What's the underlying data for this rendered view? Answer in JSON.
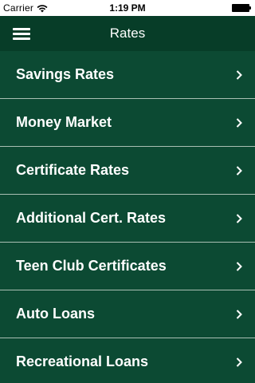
{
  "status_bar": {
    "carrier": "Carrier",
    "time": "1:19 PM",
    "icons": [
      "wifi-icon",
      "battery-icon"
    ]
  },
  "nav": {
    "title": "Rates",
    "menu_icon": "hamburger-menu-icon"
  },
  "colors": {
    "background": "#0c4a33",
    "nav_background": "#073d28",
    "text": "#ffffff",
    "separator": "#a9bfb3"
  },
  "list": {
    "items": [
      {
        "label": "Savings Rates"
      },
      {
        "label": "Money Market"
      },
      {
        "label": "Certificate Rates"
      },
      {
        "label": "Additional Cert. Rates"
      },
      {
        "label": "Teen Club Certificates"
      },
      {
        "label": "Auto Loans"
      },
      {
        "label": "Recreational Loans"
      }
    ],
    "row_icon": "chevron-right-icon"
  }
}
